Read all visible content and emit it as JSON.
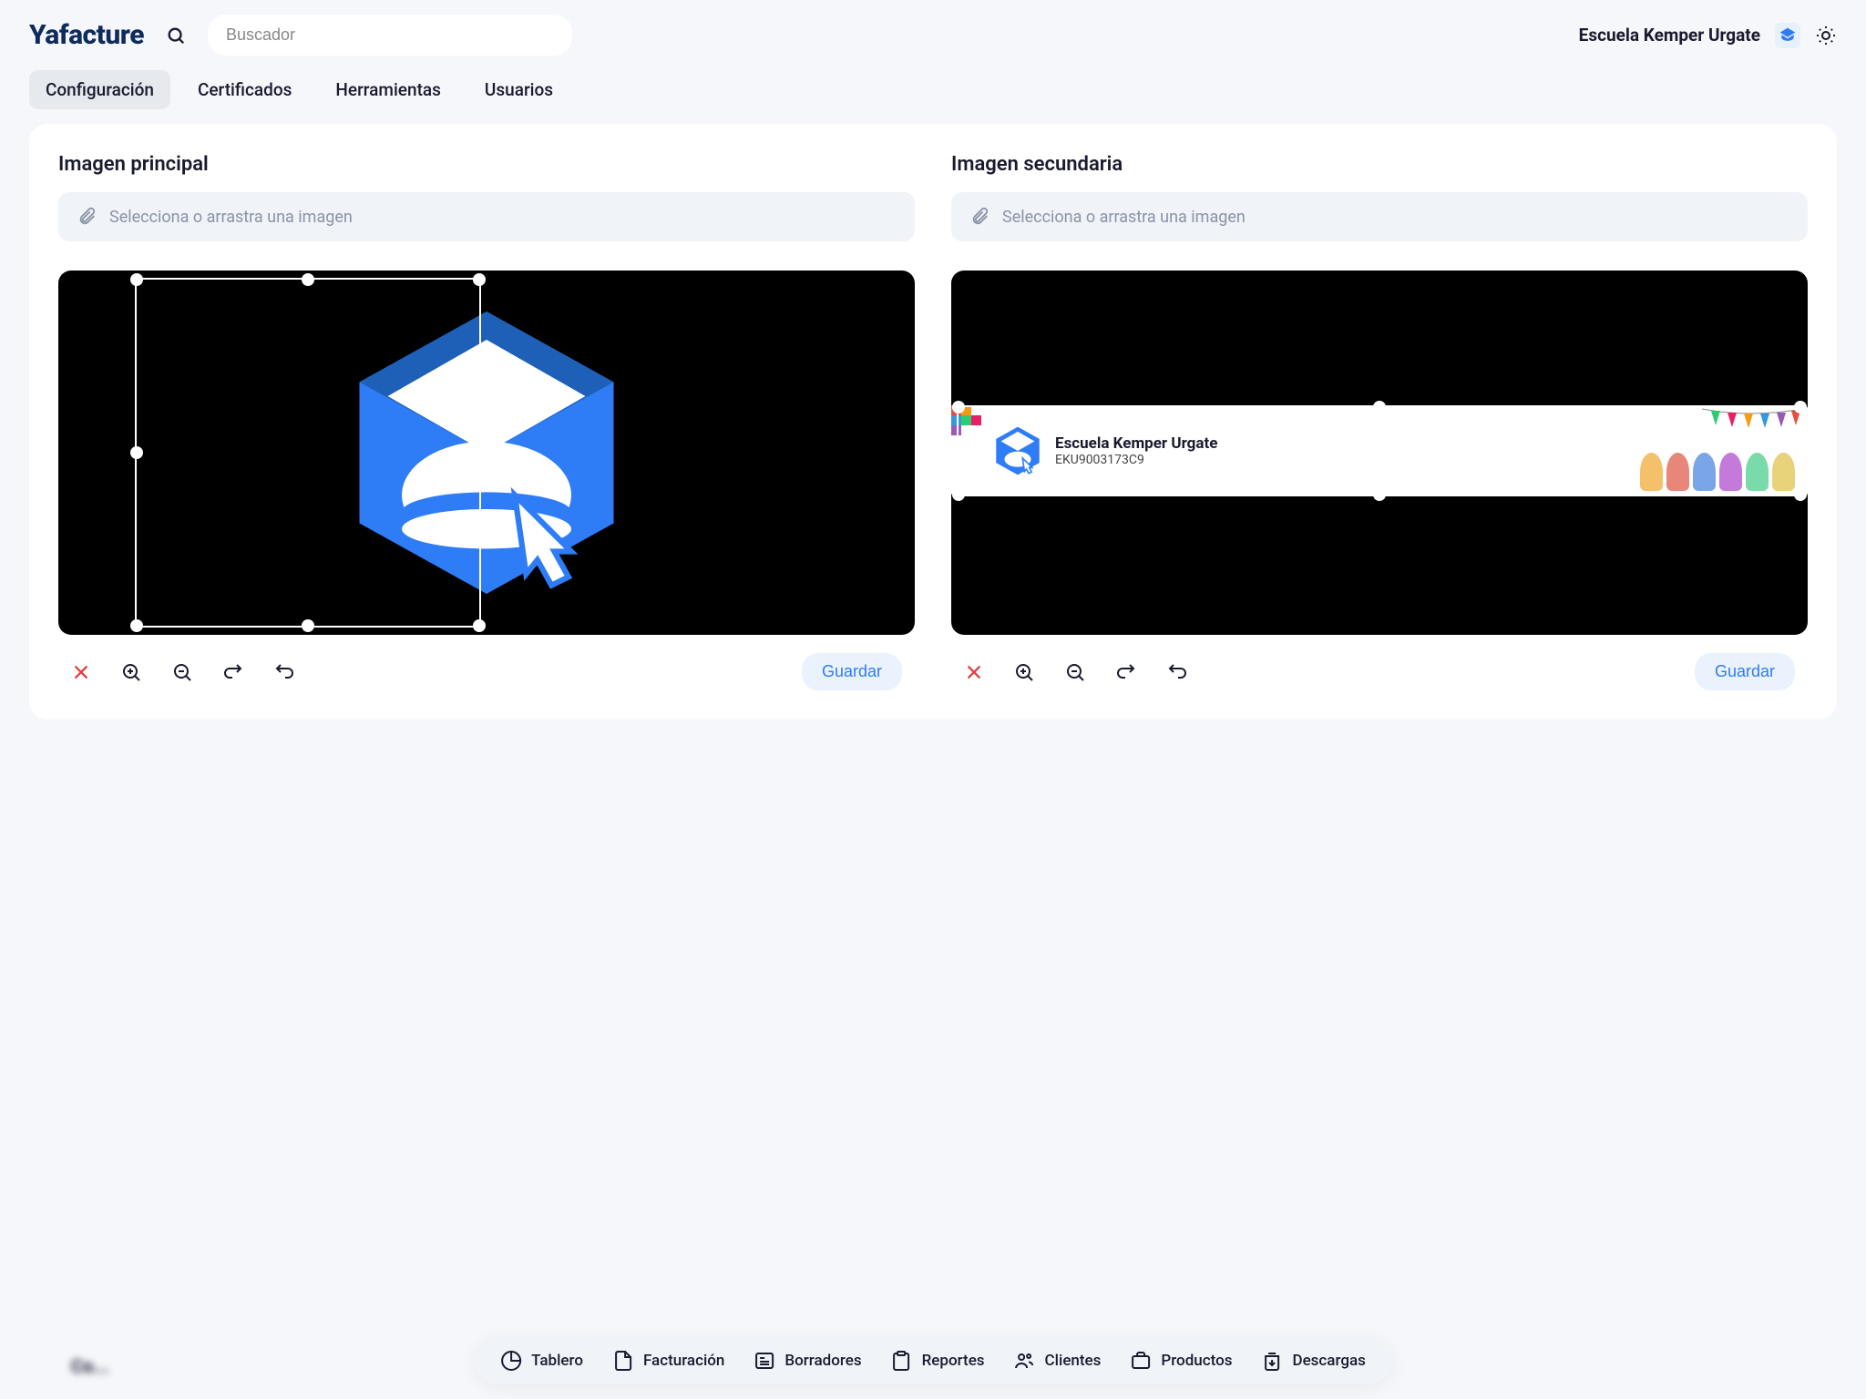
{
  "brand": "Yafacture",
  "search": {
    "placeholder": "Buscador"
  },
  "org": {
    "name": "Escuela Kemper Urgate",
    "rfc": "EKU9003173C9"
  },
  "tabs": [
    {
      "label": "Configuración",
      "active": true
    },
    {
      "label": "Certificados",
      "active": false
    },
    {
      "label": "Herramientas",
      "active": false
    },
    {
      "label": "Usuarios",
      "active": false
    }
  ],
  "sections": {
    "primary": {
      "title": "Imagen principal",
      "dropzone": "Selecciona o arrastra una imagen",
      "save": "Guardar"
    },
    "secondary": {
      "title": "Imagen secundaria",
      "dropzone": "Selecciona o arrastra una imagen",
      "save": "Guardar"
    }
  },
  "bottom_nav": [
    {
      "label": "Tablero"
    },
    {
      "label": "Facturación"
    },
    {
      "label": "Borradores"
    },
    {
      "label": "Reportes"
    },
    {
      "label": "Clientes"
    },
    {
      "label": "Productos"
    },
    {
      "label": "Descargas"
    }
  ],
  "colors": {
    "accent": "#2e7cf6",
    "danger": "#e03e3e"
  }
}
